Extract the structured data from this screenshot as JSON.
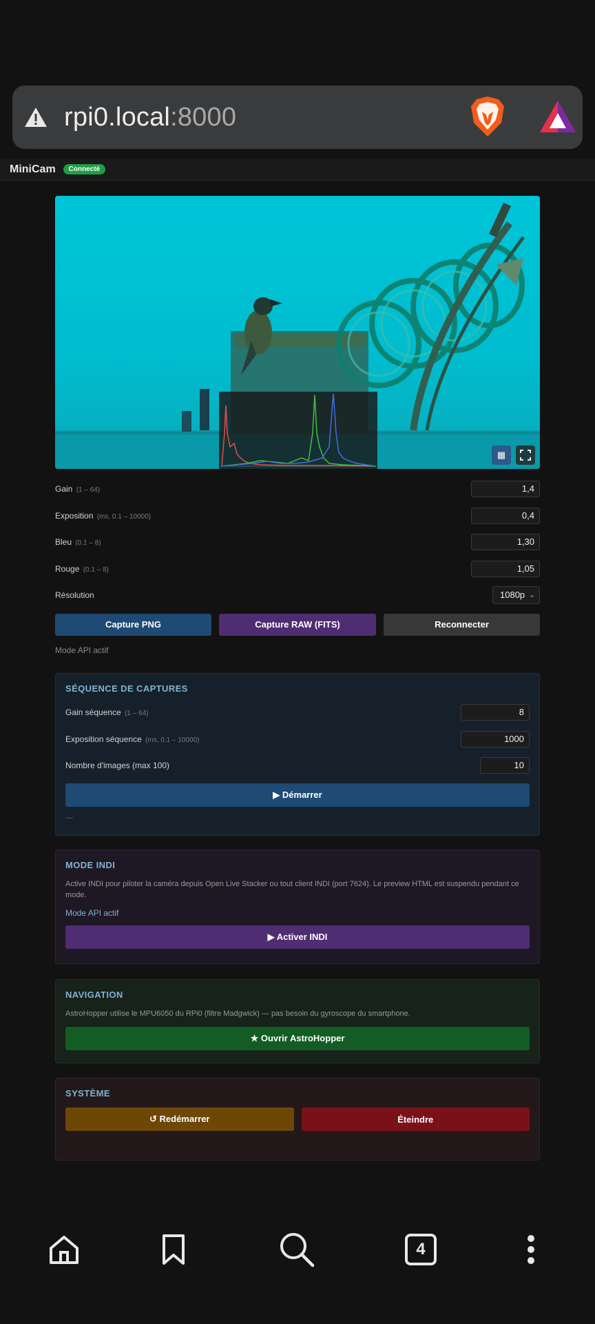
{
  "browser": {
    "url_host": "rpi0.local",
    "url_port": ":8000",
    "tab_count": "4"
  },
  "app": {
    "name": "MiniCam",
    "status": "Connecté"
  },
  "controls": {
    "gain": {
      "label": "Gain",
      "hint": "(1 – 64)",
      "value": "1,4"
    },
    "exposure": {
      "label": "Exposition",
      "hint": "(ms, 0.1 – 10000)",
      "value": "0,4"
    },
    "blue": {
      "label": "Bleu",
      "hint": "(0.1 – 8)",
      "value": "1,30"
    },
    "red": {
      "label": "Rouge",
      "hint": "(0.1 – 8)",
      "value": "1,05"
    },
    "resolution": {
      "label": "Résolution",
      "value": "1080p"
    }
  },
  "actions": {
    "capture_png": "Capture PNG",
    "capture_raw": "Capture RAW (FITS)",
    "reconnect": "Reconnecter"
  },
  "mode_status": "Mode API actif",
  "sequence": {
    "title": "SÉQUENCE DE CAPTURES",
    "gain_label": "Gain séquence",
    "gain_hint": "(1 – 64)",
    "gain_value": "8",
    "exposure_label": "Exposition séquence",
    "exposure_hint": "(ms, 0.1 – 10000)",
    "exposure_value": "1000",
    "count_label": "Nombre d'images (max 100)",
    "count_value": "10",
    "start_label": "▶ Démarrer",
    "status": "—"
  },
  "indi": {
    "title": "MODE INDI",
    "description": "Active INDI pour piloter la caméra depuis Open Live Stacker ou tout client INDI (port 7624). Le preview HTML est suspendu pendant ce mode.",
    "status": "Mode API actif",
    "button": "▶ Activer INDI"
  },
  "navigation": {
    "title": "NAVIGATION",
    "description": "AstroHopper utilise le MPU6050 du RPi0 (filtre Madgwick) — pas besoin du gyroscope du smartphone.",
    "button": "★ Ouvrir AstroHopper"
  },
  "system": {
    "title": "SYSTÈME",
    "restart": "↺ Redémarrer",
    "shutdown": " Éteindre"
  },
  "colors": {
    "blue_btn": "#1e4a73",
    "purple_btn": "#4f2d72",
    "green_btn": "#135d24",
    "orange_btn": "#6e4606",
    "red_btn": "#7a1118",
    "accent_title": "#7fb3d3"
  }
}
